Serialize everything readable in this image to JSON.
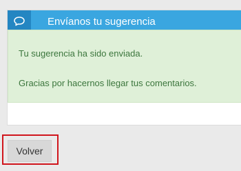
{
  "panel": {
    "title": "Envíanos tu sugerencia",
    "icon": "speech-bubble-icon",
    "header_color": "#3aa6e0",
    "icon_bg_color": "#2486c2"
  },
  "alert": {
    "line1": "Tu sugerencia ha sido enviada.",
    "line2": "Gracias por hacernos llegar tus comentarios.",
    "bg_color": "#dff0d8",
    "text_color": "#3c763d"
  },
  "actions": {
    "back_label": "Volver",
    "highlight_color": "#d0151c"
  }
}
